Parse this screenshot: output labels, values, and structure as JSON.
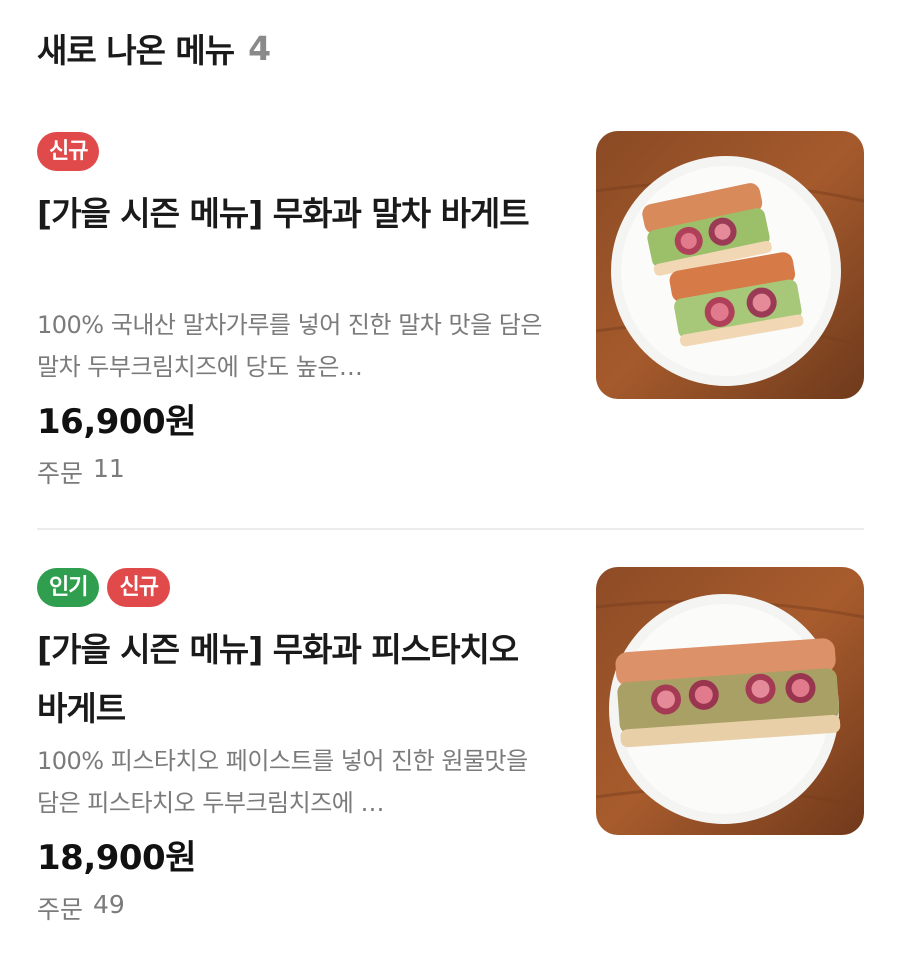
{
  "section": {
    "title": "새로 나온 메뉴",
    "count": "4"
  },
  "items": [
    {
      "badges": [
        "신규"
      ],
      "name": "[가을 시즌 메뉴] 무화과 말차 바게트",
      "description": "100% 국내산 말차가루를 넣어 진한 말차 맛을 담은 말차 두부크림치즈에 당도 높은…",
      "price": "16,900원",
      "orders_label": "주문",
      "orders_count": "11",
      "image_icon": "fig-matcha-baguette-photo"
    },
    {
      "badges": [
        "인기",
        "신규"
      ],
      "name": "[가을 시즌 메뉴] 무화과 피스타치오 바게트",
      "description": "100% 피스타치오 페이스트를 넣어 진한 원물맛을 담은 피스타치오 두부크림치즈에 …",
      "price": "18,900원",
      "orders_label": "주문",
      "orders_count": "49",
      "image_icon": "fig-pistachio-baguette-photo"
    }
  ],
  "colors": {
    "badge_new": "#e04a4a",
    "badge_popular": "#2f9e4f",
    "muted_text": "#7b7b7b"
  }
}
